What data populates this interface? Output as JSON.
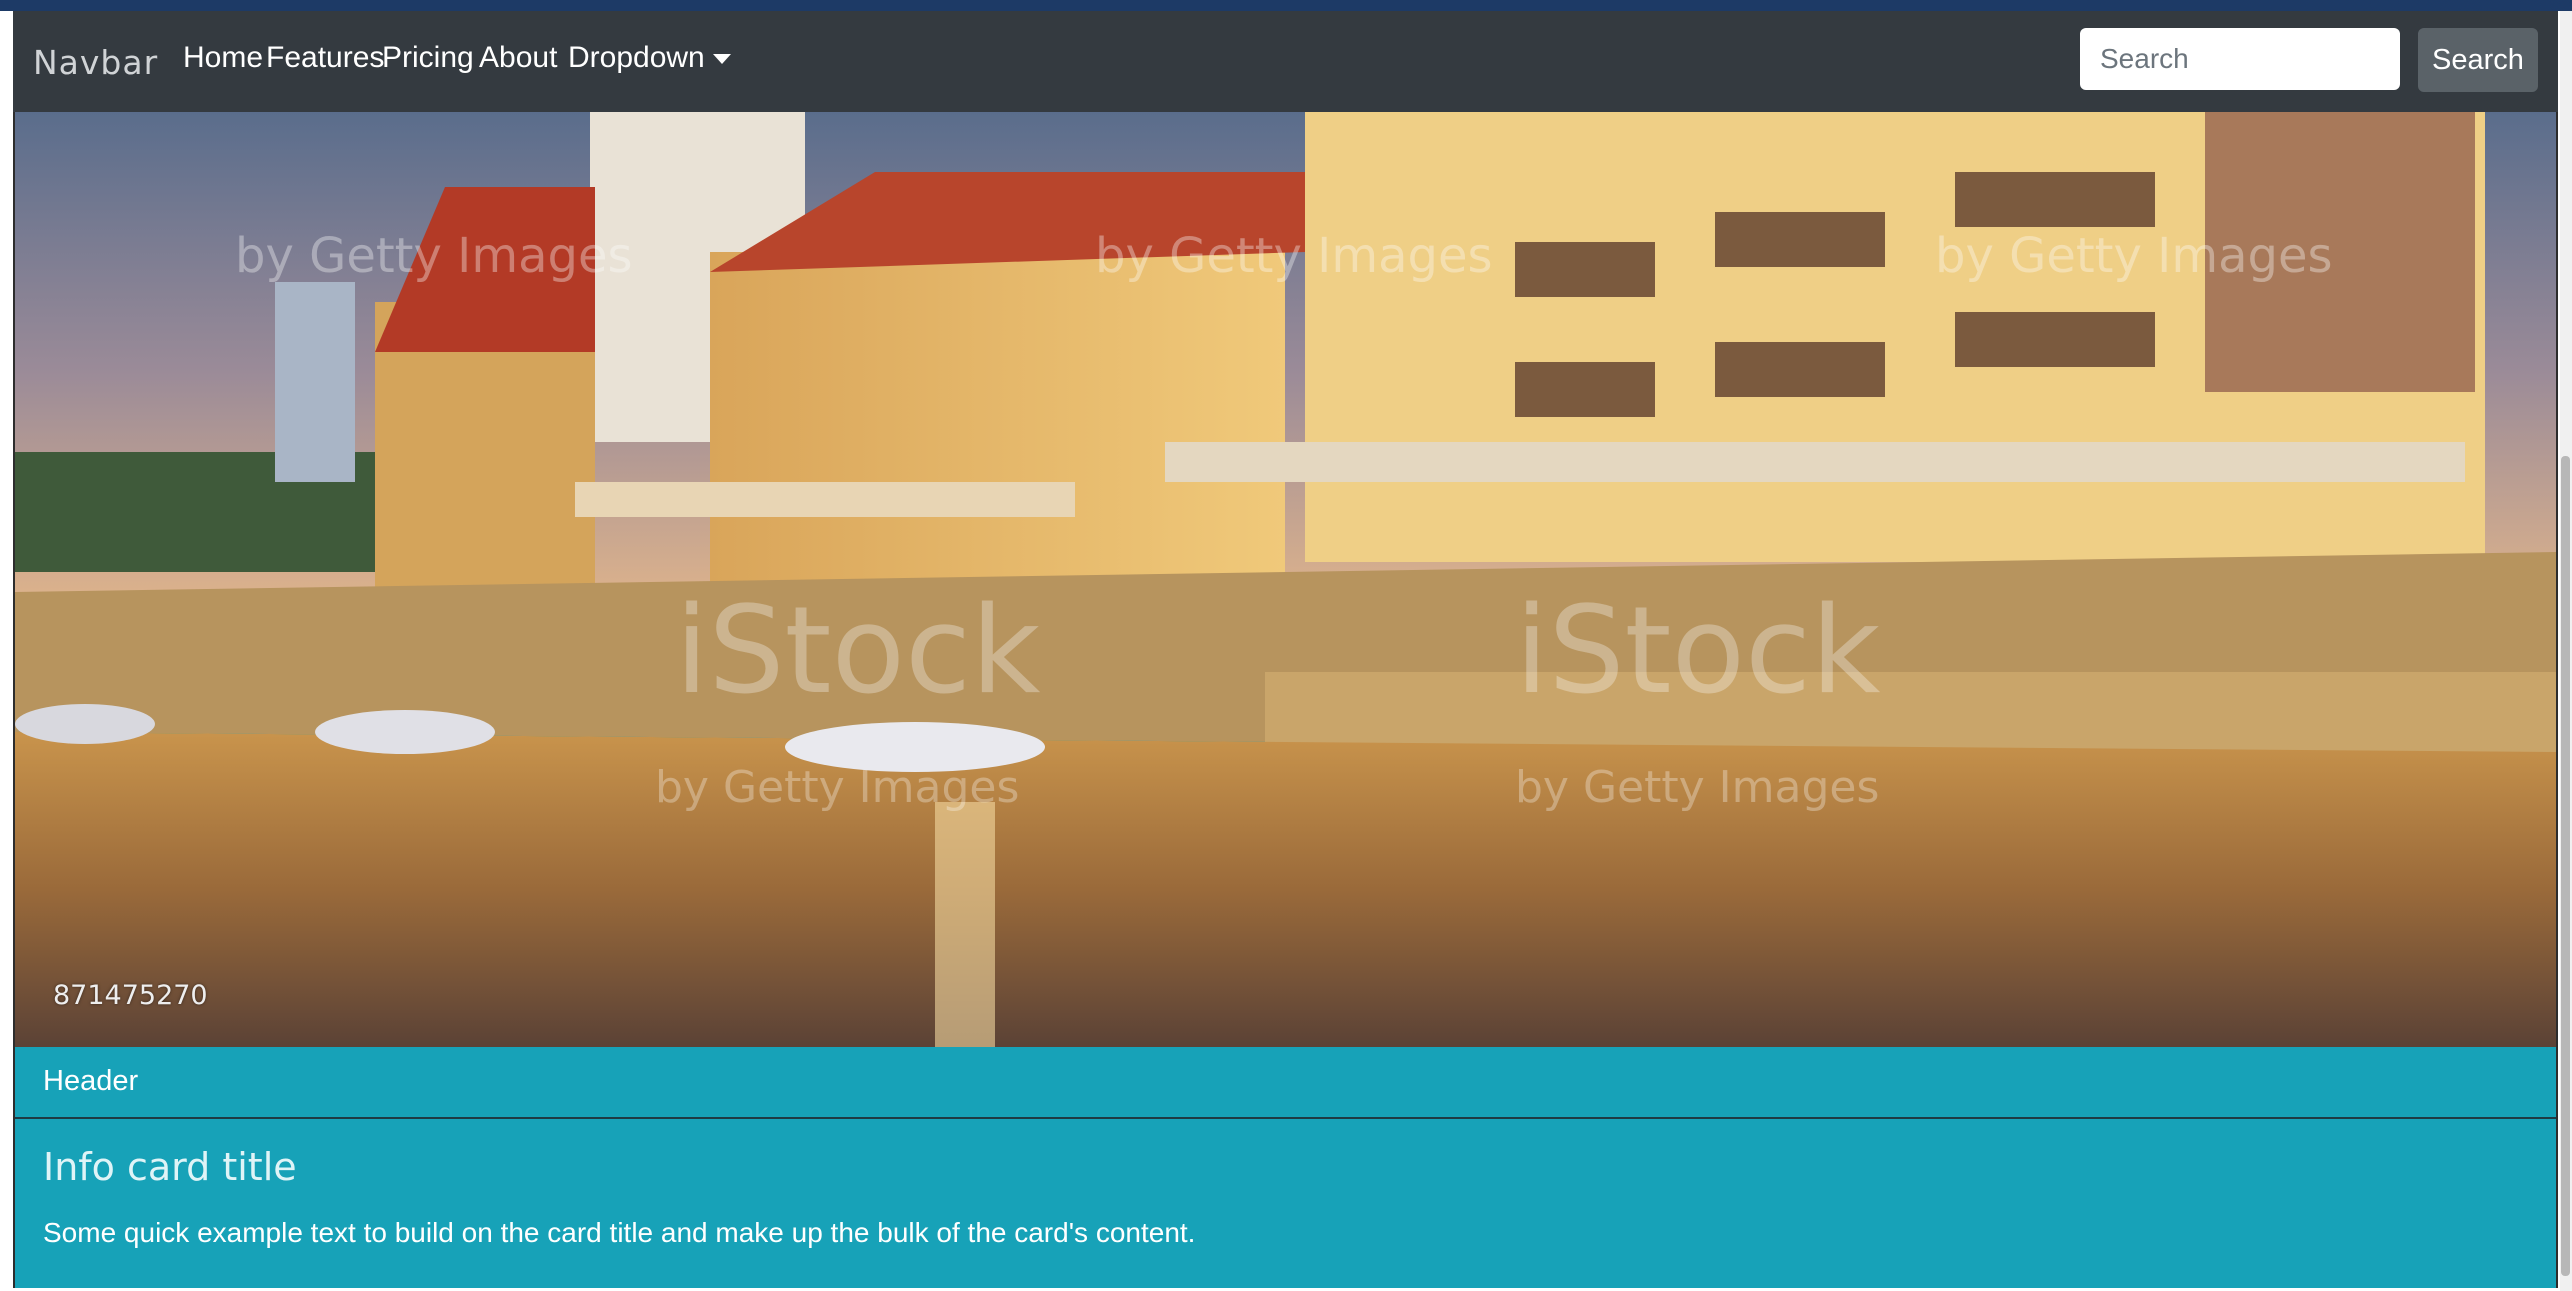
{
  "navbar": {
    "brand": "Navbar",
    "links": [
      "Home",
      "Features",
      "Pricing",
      "About",
      "Dropdown"
    ],
    "search": {
      "placeholder": "Search",
      "button_label": "Search"
    },
    "background": "#343a40"
  },
  "card": {
    "image": {
      "id_text": "871475270",
      "watermark": "iStock",
      "watermark_sub": "by Getty Images"
    },
    "header": "Header",
    "title": "Info card title",
    "text": "Some quick example text to build on the card title and make up the bulk of the card's content.",
    "color": "#17a2b8"
  }
}
